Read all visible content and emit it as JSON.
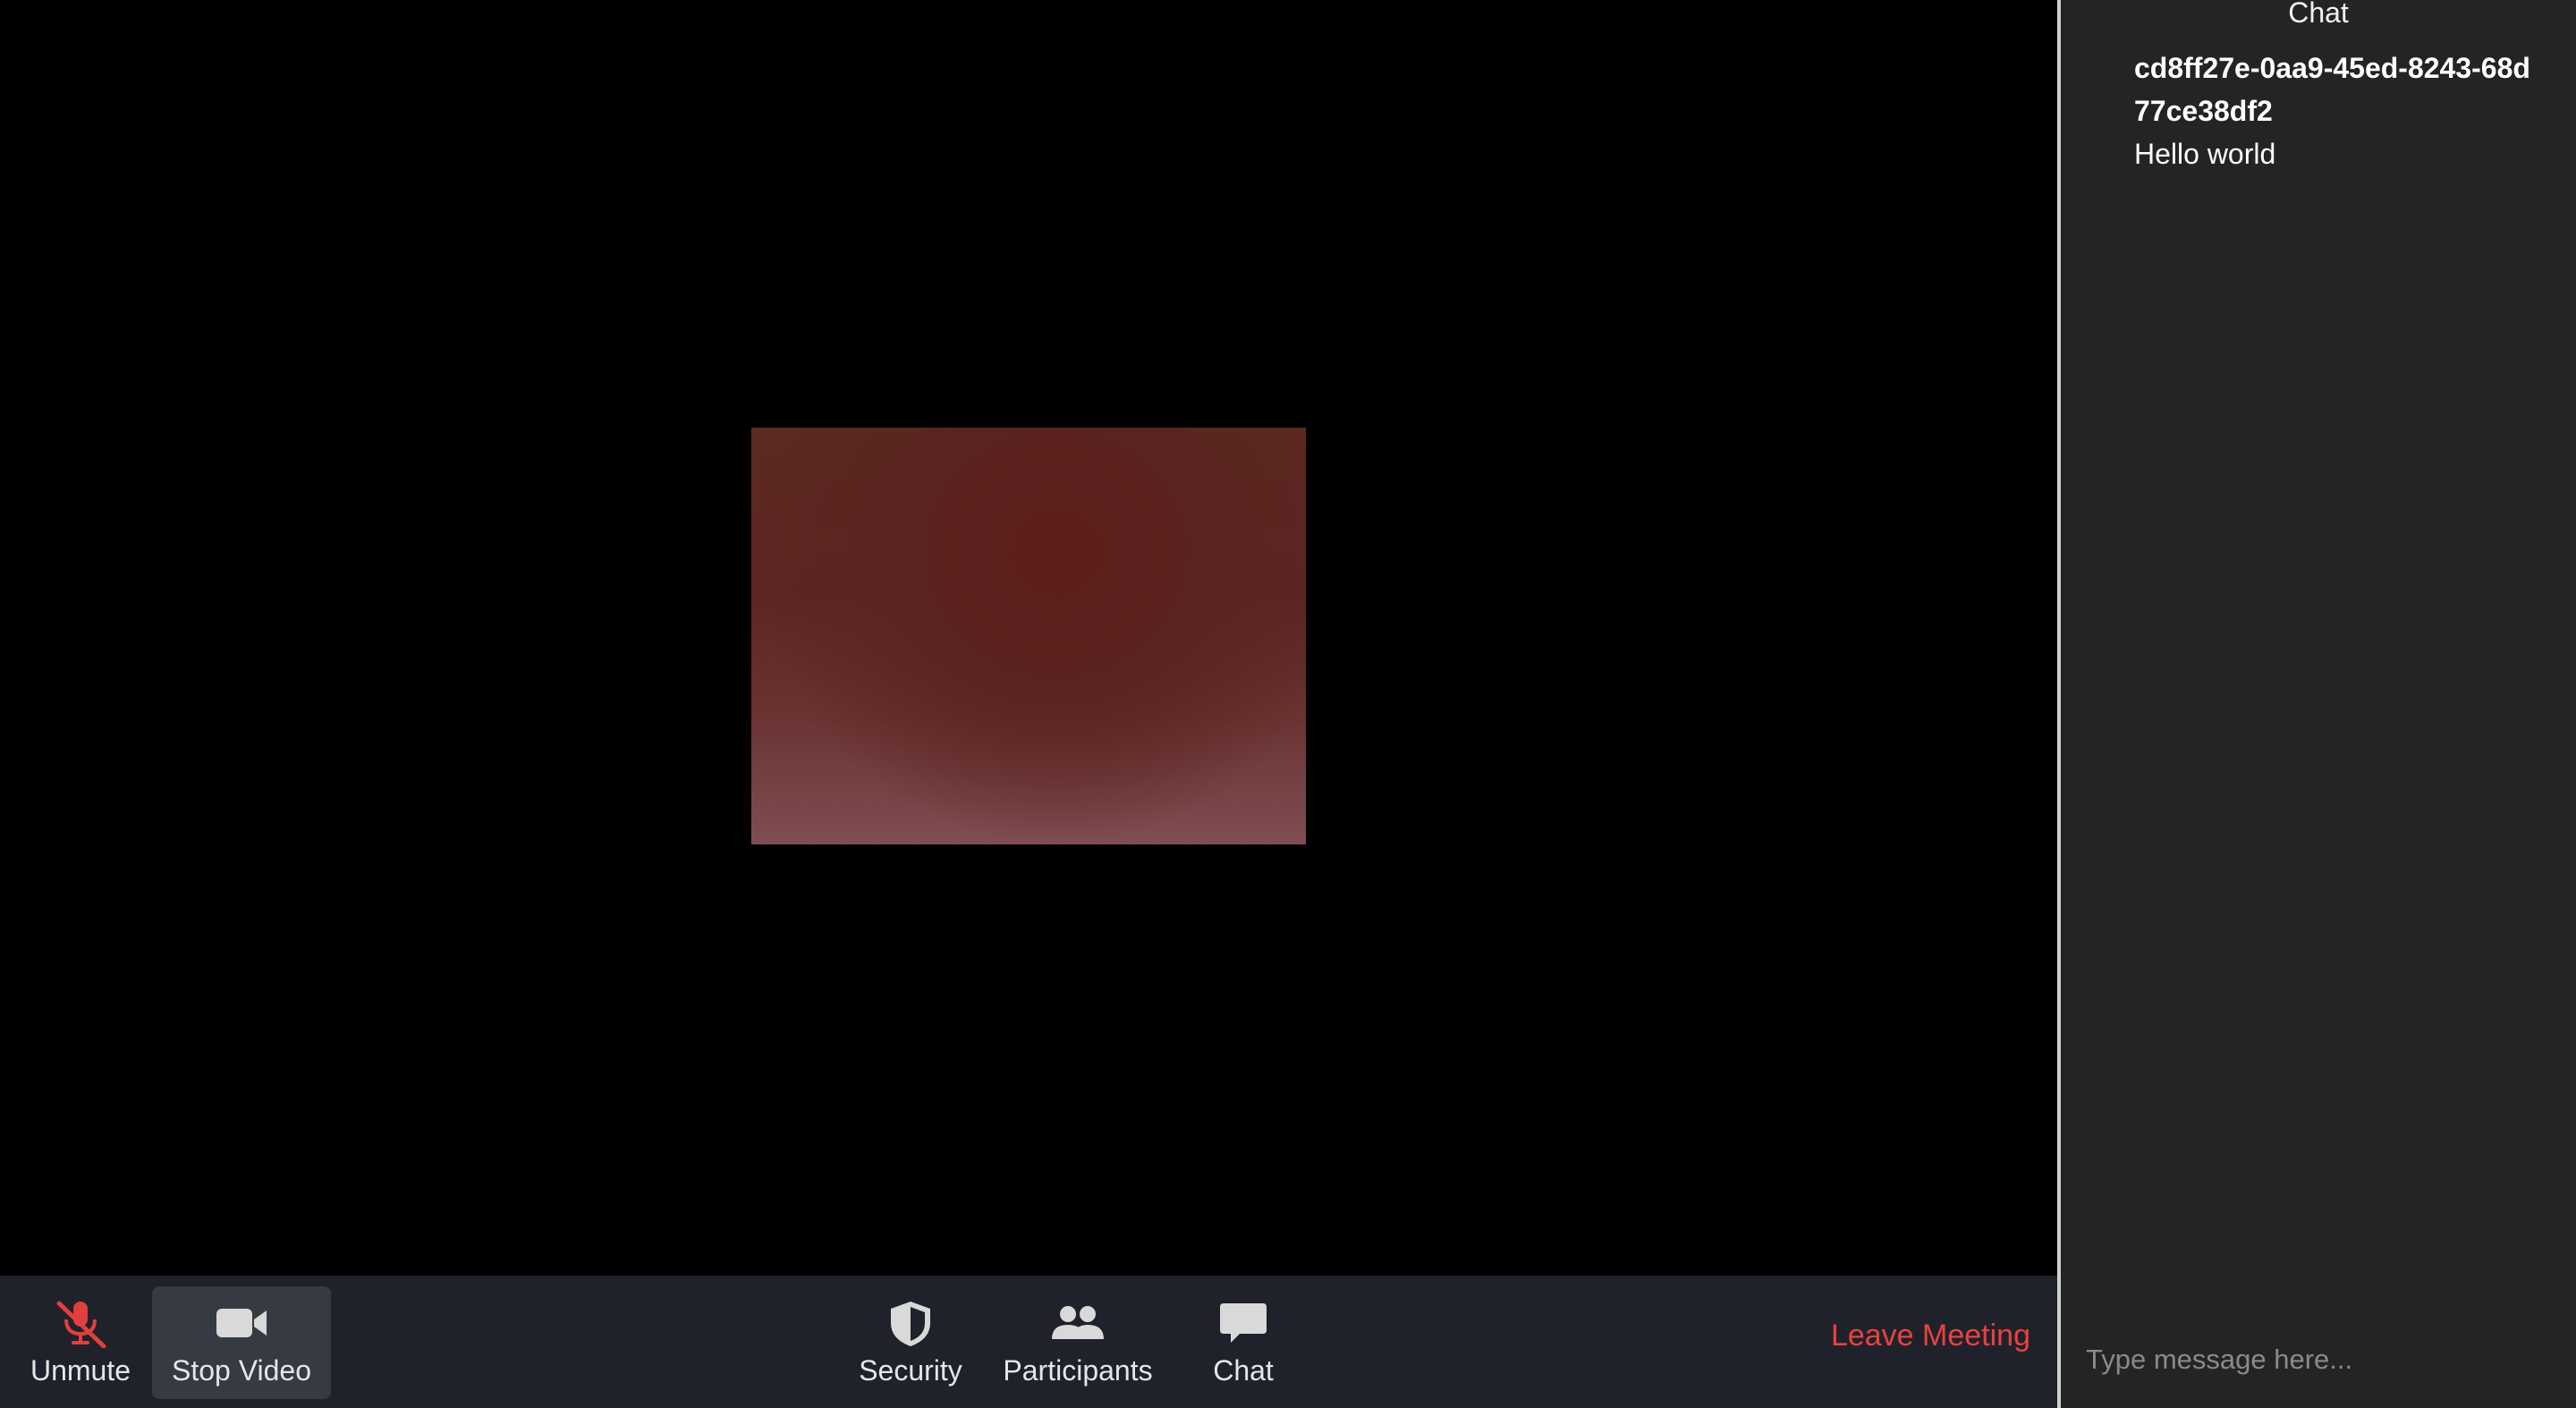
{
  "toolbar": {
    "unmute_label": "Unmute",
    "stop_video_label": "Stop Video",
    "security_label": "Security",
    "participants_label": "Participants",
    "chat_label": "Chat",
    "leave_label": "Leave Meeting",
    "icons": {
      "unmute": "microphone-muted-icon",
      "stop_video": "video-camera-icon",
      "security": "shield-icon",
      "participants": "participants-icon",
      "chat": "chat-bubble-icon"
    }
  },
  "chat_panel": {
    "title": "Chat",
    "messages": [
      {
        "sender": "cd8ff27e-0aa9-45ed-8243-68d77ce38df2",
        "text": "Hello world"
      }
    ],
    "input_placeholder": "Type message here..."
  },
  "colors": {
    "toolbar_bg": "#1f222b",
    "chat_bg": "#242424",
    "leave_red": "#e8423f",
    "mute_red": "#e0403d",
    "icon_gray": "#d9d9d9"
  }
}
